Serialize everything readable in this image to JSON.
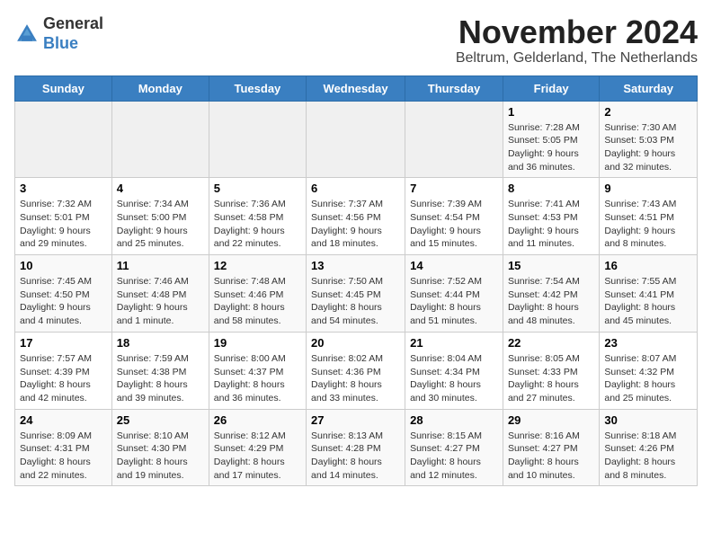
{
  "header": {
    "logo_line1": "General",
    "logo_line2": "Blue",
    "title": "November 2024",
    "subtitle": "Beltrum, Gelderland, The Netherlands"
  },
  "weekdays": [
    "Sunday",
    "Monday",
    "Tuesday",
    "Wednesday",
    "Thursday",
    "Friday",
    "Saturday"
  ],
  "weeks": [
    [
      {
        "day": "",
        "info": ""
      },
      {
        "day": "",
        "info": ""
      },
      {
        "day": "",
        "info": ""
      },
      {
        "day": "",
        "info": ""
      },
      {
        "day": "",
        "info": ""
      },
      {
        "day": "1",
        "info": "Sunrise: 7:28 AM\nSunset: 5:05 PM\nDaylight: 9 hours and 36 minutes."
      },
      {
        "day": "2",
        "info": "Sunrise: 7:30 AM\nSunset: 5:03 PM\nDaylight: 9 hours and 32 minutes."
      }
    ],
    [
      {
        "day": "3",
        "info": "Sunrise: 7:32 AM\nSunset: 5:01 PM\nDaylight: 9 hours and 29 minutes."
      },
      {
        "day": "4",
        "info": "Sunrise: 7:34 AM\nSunset: 5:00 PM\nDaylight: 9 hours and 25 minutes."
      },
      {
        "day": "5",
        "info": "Sunrise: 7:36 AM\nSunset: 4:58 PM\nDaylight: 9 hours and 22 minutes."
      },
      {
        "day": "6",
        "info": "Sunrise: 7:37 AM\nSunset: 4:56 PM\nDaylight: 9 hours and 18 minutes."
      },
      {
        "day": "7",
        "info": "Sunrise: 7:39 AM\nSunset: 4:54 PM\nDaylight: 9 hours and 15 minutes."
      },
      {
        "day": "8",
        "info": "Sunrise: 7:41 AM\nSunset: 4:53 PM\nDaylight: 9 hours and 11 minutes."
      },
      {
        "day": "9",
        "info": "Sunrise: 7:43 AM\nSunset: 4:51 PM\nDaylight: 9 hours and 8 minutes."
      }
    ],
    [
      {
        "day": "10",
        "info": "Sunrise: 7:45 AM\nSunset: 4:50 PM\nDaylight: 9 hours and 4 minutes."
      },
      {
        "day": "11",
        "info": "Sunrise: 7:46 AM\nSunset: 4:48 PM\nDaylight: 9 hours and 1 minute."
      },
      {
        "day": "12",
        "info": "Sunrise: 7:48 AM\nSunset: 4:46 PM\nDaylight: 8 hours and 58 minutes."
      },
      {
        "day": "13",
        "info": "Sunrise: 7:50 AM\nSunset: 4:45 PM\nDaylight: 8 hours and 54 minutes."
      },
      {
        "day": "14",
        "info": "Sunrise: 7:52 AM\nSunset: 4:44 PM\nDaylight: 8 hours and 51 minutes."
      },
      {
        "day": "15",
        "info": "Sunrise: 7:54 AM\nSunset: 4:42 PM\nDaylight: 8 hours and 48 minutes."
      },
      {
        "day": "16",
        "info": "Sunrise: 7:55 AM\nSunset: 4:41 PM\nDaylight: 8 hours and 45 minutes."
      }
    ],
    [
      {
        "day": "17",
        "info": "Sunrise: 7:57 AM\nSunset: 4:39 PM\nDaylight: 8 hours and 42 minutes."
      },
      {
        "day": "18",
        "info": "Sunrise: 7:59 AM\nSunset: 4:38 PM\nDaylight: 8 hours and 39 minutes."
      },
      {
        "day": "19",
        "info": "Sunrise: 8:00 AM\nSunset: 4:37 PM\nDaylight: 8 hours and 36 minutes."
      },
      {
        "day": "20",
        "info": "Sunrise: 8:02 AM\nSunset: 4:36 PM\nDaylight: 8 hours and 33 minutes."
      },
      {
        "day": "21",
        "info": "Sunrise: 8:04 AM\nSunset: 4:34 PM\nDaylight: 8 hours and 30 minutes."
      },
      {
        "day": "22",
        "info": "Sunrise: 8:05 AM\nSunset: 4:33 PM\nDaylight: 8 hours and 27 minutes."
      },
      {
        "day": "23",
        "info": "Sunrise: 8:07 AM\nSunset: 4:32 PM\nDaylight: 8 hours and 25 minutes."
      }
    ],
    [
      {
        "day": "24",
        "info": "Sunrise: 8:09 AM\nSunset: 4:31 PM\nDaylight: 8 hours and 22 minutes."
      },
      {
        "day": "25",
        "info": "Sunrise: 8:10 AM\nSunset: 4:30 PM\nDaylight: 8 hours and 19 minutes."
      },
      {
        "day": "26",
        "info": "Sunrise: 8:12 AM\nSunset: 4:29 PM\nDaylight: 8 hours and 17 minutes."
      },
      {
        "day": "27",
        "info": "Sunrise: 8:13 AM\nSunset: 4:28 PM\nDaylight: 8 hours and 14 minutes."
      },
      {
        "day": "28",
        "info": "Sunrise: 8:15 AM\nSunset: 4:27 PM\nDaylight: 8 hours and 12 minutes."
      },
      {
        "day": "29",
        "info": "Sunrise: 8:16 AM\nSunset: 4:27 PM\nDaylight: 8 hours and 10 minutes."
      },
      {
        "day": "30",
        "info": "Sunrise: 8:18 AM\nSunset: 4:26 PM\nDaylight: 8 hours and 8 minutes."
      }
    ]
  ]
}
